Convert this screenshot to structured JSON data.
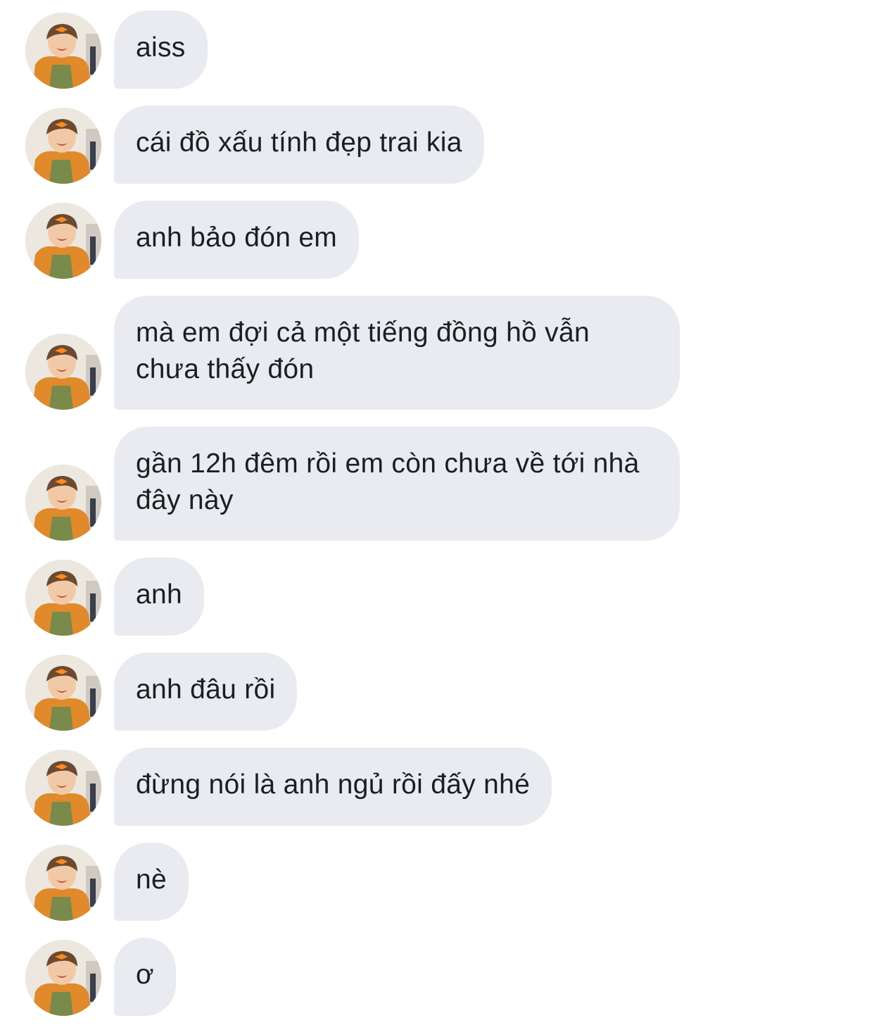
{
  "thread": {
    "messages": [
      {
        "text": "aiss",
        "avatar_icon": "avatar-photo-icon"
      },
      {
        "text": "cái đồ xấu tính đẹp trai kia",
        "avatar_icon": "avatar-photo-icon"
      },
      {
        "text": "anh bảo đón em",
        "avatar_icon": "avatar-photo-icon"
      },
      {
        "text": "mà em đợi cả một tiếng đồng hồ vẫn chưa thấy đón",
        "avatar_icon": "avatar-photo-icon"
      },
      {
        "text": "gần 12h đêm rồi em còn chưa về tới nhà đây này",
        "avatar_icon": "avatar-photo-icon"
      },
      {
        "text": "anh",
        "avatar_icon": "avatar-photo-icon"
      },
      {
        "text": "anh đâu rồi",
        "avatar_icon": "avatar-photo-icon"
      },
      {
        "text": "đừng nói là anh ngủ rồi đấy nhé",
        "avatar_icon": "avatar-photo-icon"
      },
      {
        "text": "nè",
        "avatar_icon": "avatar-photo-icon"
      },
      {
        "text": "ơ",
        "avatar_icon": "avatar-photo-icon"
      }
    ]
  },
  "colors": {
    "bubble_bg": "#e9ebf0",
    "text": "#1c1e21",
    "background": "#ffffff"
  }
}
